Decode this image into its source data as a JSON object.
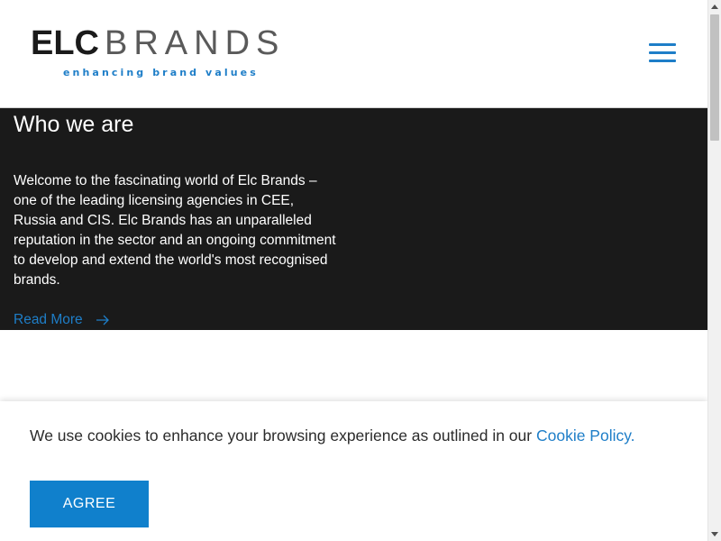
{
  "header": {
    "logo": {
      "wordmark_left": "ELC",
      "wordmark_right": "BRANDS",
      "tagline": "enhancing brand values"
    },
    "menu_icon": "hamburger-menu-icon"
  },
  "about": {
    "title": "Who we are",
    "body": "Welcome to the fascinating world of Elc Brands – one of the leading licensing agencies in CEE, Russia and CIS. Elc Brands has an unparalleled reputation in the sector and an ongoing commitment to develop and extend the world's most recognised brands.",
    "read_more_label": "Read More",
    "read_more_icon": "arrow-right-icon"
  },
  "cookie_banner": {
    "text": "We use cookies to enhance your browsing experience as outlined in our ",
    "link_label": "Cookie Policy.",
    "agree_label": "AGREE"
  },
  "colors": {
    "accent": "#1e7ec8",
    "button": "#1080cc",
    "dark_section": "#1a1a1a",
    "logo_elc": "#1a1a1a",
    "logo_brands": "#5a5a5a"
  }
}
